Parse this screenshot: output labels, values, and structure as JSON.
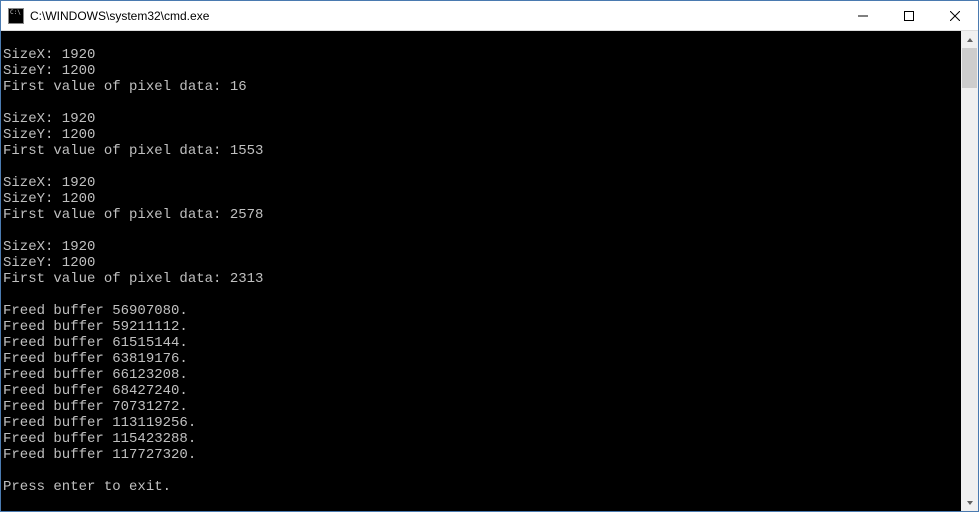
{
  "window": {
    "title": "C:\\WINDOWS\\system32\\cmd.exe"
  },
  "console": {
    "measurements": [
      {
        "sizeX": 1920,
        "sizeY": 1200,
        "firstPixel": 16
      },
      {
        "sizeX": 1920,
        "sizeY": 1200,
        "firstPixel": 1553
      },
      {
        "sizeX": 1920,
        "sizeY": 1200,
        "firstPixel": 2578
      },
      {
        "sizeX": 1920,
        "sizeY": 1200,
        "firstPixel": 2313
      }
    ],
    "freedBuffers": [
      56907080,
      59211112,
      61515144,
      63819176,
      66123208,
      68427240,
      70731272,
      113119256,
      115423288,
      117727320
    ],
    "prompt": "Press enter to exit.",
    "labels": {
      "sizeX": "SizeX:",
      "sizeY": "SizeY:",
      "firstPixel": "First value of pixel data:",
      "freedBuffer": "Freed buffer"
    }
  }
}
